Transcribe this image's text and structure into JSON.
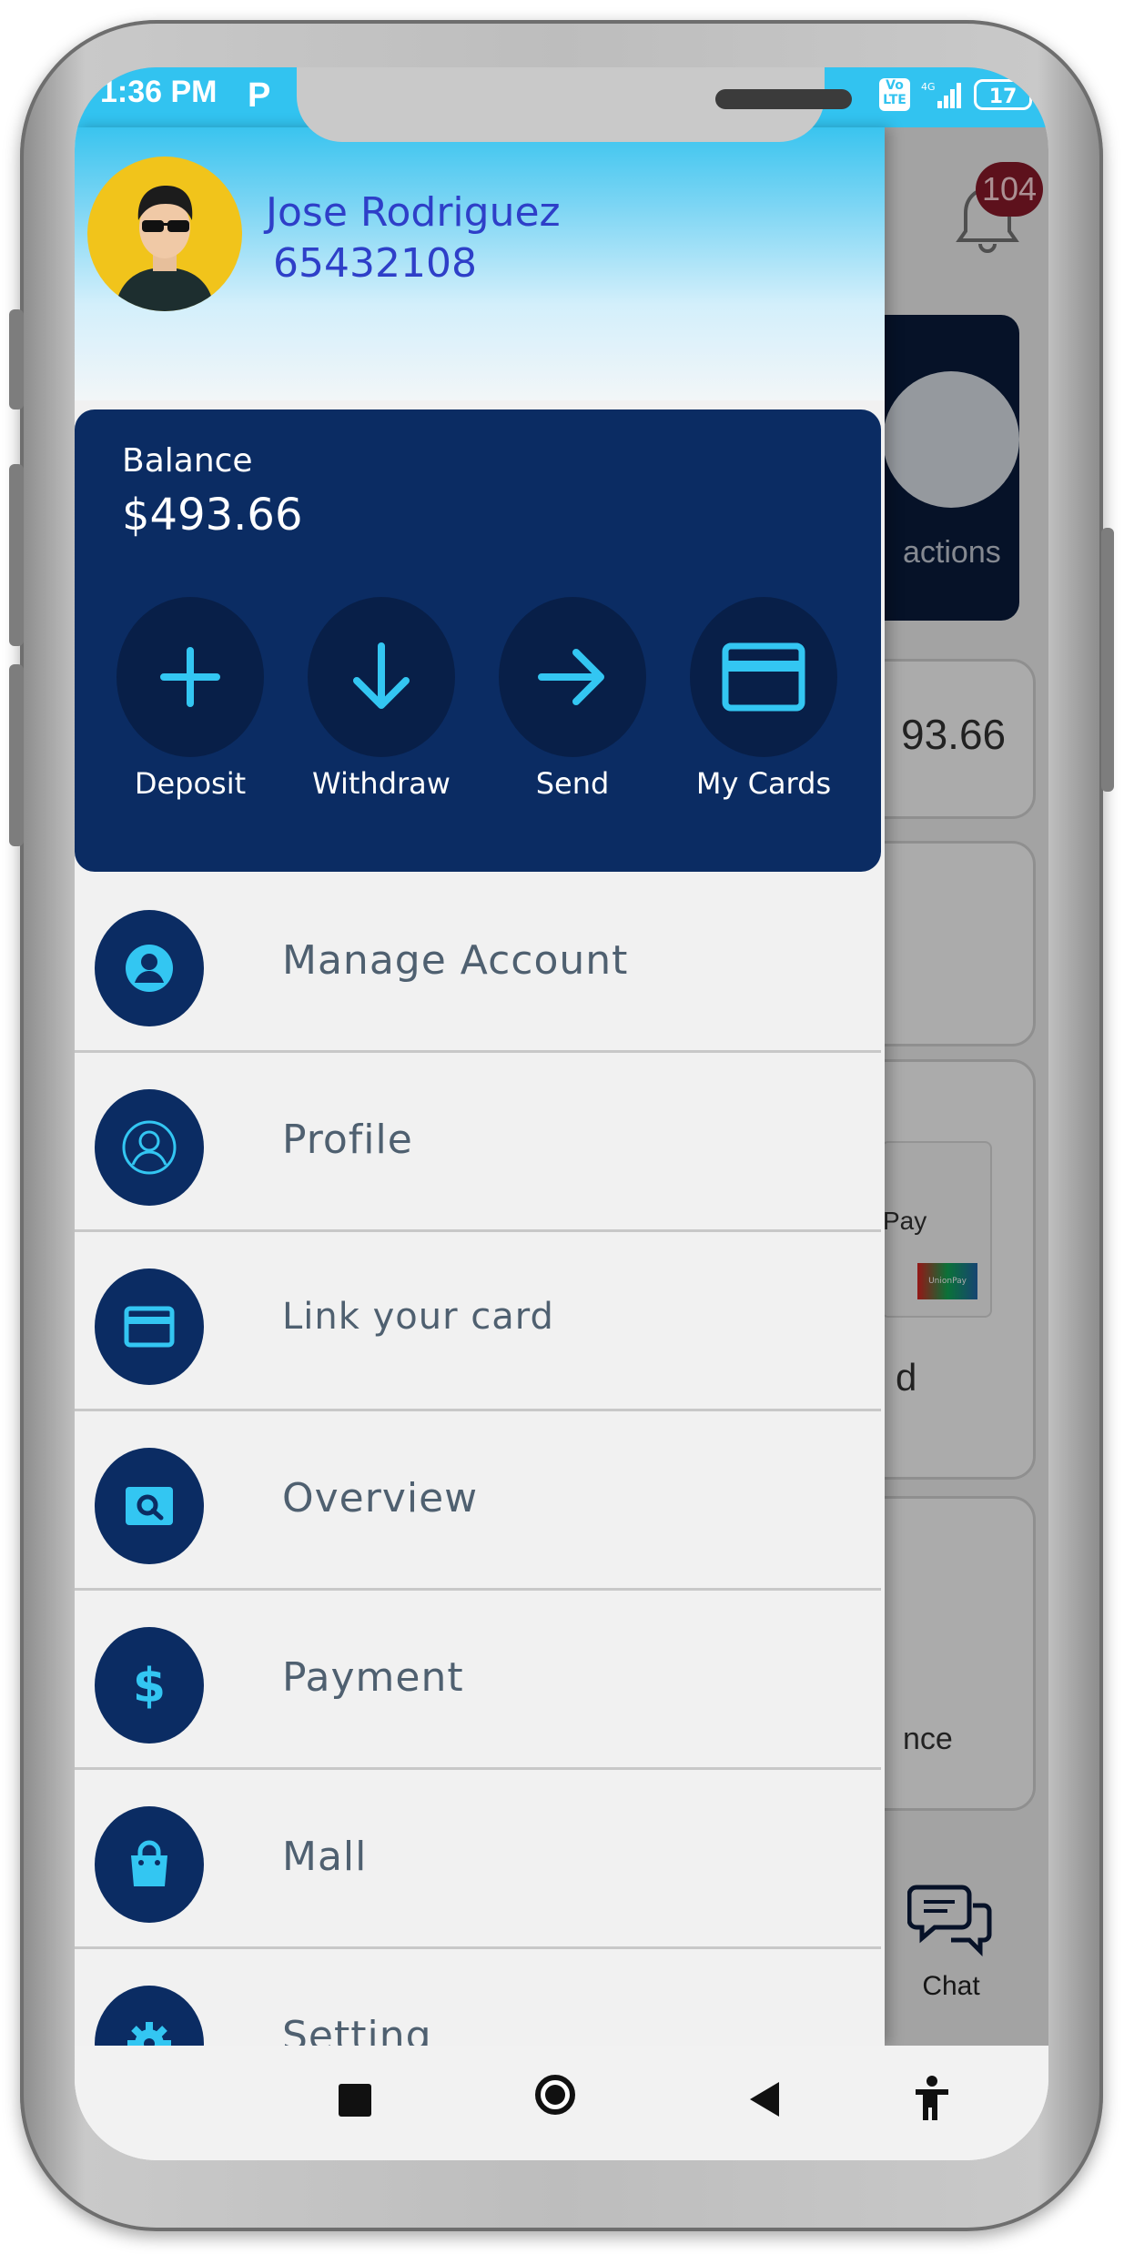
{
  "status_bar": {
    "time": "1:36 PM",
    "carrier_icon": "P",
    "lte": "Vo LTE",
    "network": "4G",
    "battery": "17"
  },
  "drawer": {
    "user": {
      "name": "Jose Rodriguez",
      "account_number": "65432108",
      "avatar_icon": "user-avatar-sunglasses"
    },
    "balance": {
      "label": "Balance",
      "value": "$493.66"
    },
    "quick_actions": [
      {
        "label": "Deposit",
        "icon": "plus-icon"
      },
      {
        "label": "Withdraw",
        "icon": "arrow-down-icon"
      },
      {
        "label": "Send",
        "icon": "arrow-right-icon"
      },
      {
        "label": "My Cards",
        "icon": "card-icon"
      }
    ],
    "menu": [
      {
        "label": "Manage Account",
        "icon": "account-circle-icon"
      },
      {
        "label": "Profile",
        "icon": "profile-icon"
      },
      {
        "label": "Link your card",
        "icon": "card-icon"
      },
      {
        "label": "Overview",
        "icon": "search-card-icon"
      },
      {
        "label": "Payment",
        "icon": "dollar-icon"
      },
      {
        "label": "Mall",
        "icon": "shopping-bag-icon"
      },
      {
        "label": "Setting",
        "icon": "gear-icon"
      }
    ]
  },
  "background": {
    "notification_count": "104",
    "transactions_partial": "actions",
    "balance_partial": "93.66",
    "card_partial": "d",
    "pay_partial": "Pay",
    "unionpay_text": "UnionPay",
    "service_partial": "nce",
    "chat_label": "Chat"
  },
  "colors": {
    "primary": "#0b2c63",
    "accent": "#32c3f0",
    "name": "#2e3fc8"
  }
}
